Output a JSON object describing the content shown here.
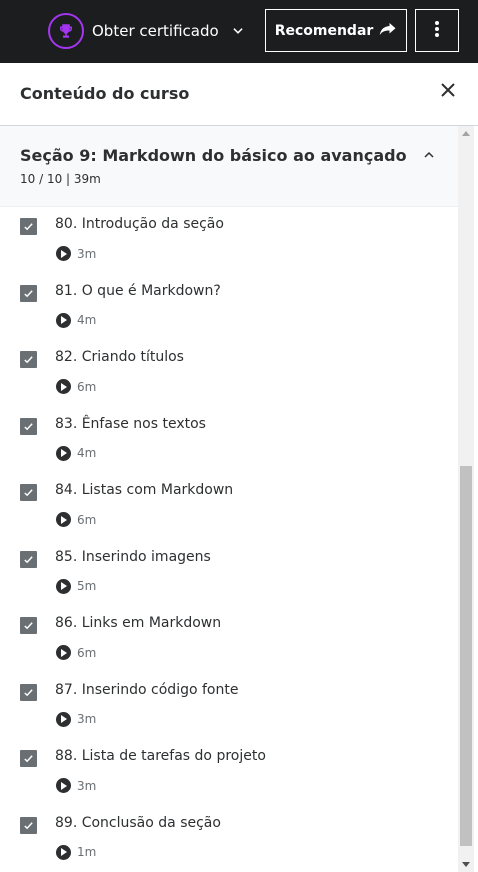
{
  "topbar": {
    "certificate_label": "Obter certificado",
    "recommend_label": "Recomendar"
  },
  "panel": {
    "title": "Conteúdo do curso"
  },
  "section": {
    "title": "Seção 9: Markdown do básico ao avançado",
    "meta": "10 / 10 | 39m"
  },
  "lectures": [
    {
      "title": "80. Introdução da seção",
      "duration": "3m",
      "completed": true
    },
    {
      "title": "81. O que é Markdown?",
      "duration": "4m",
      "completed": true
    },
    {
      "title": "82. Criando títulos",
      "duration": "6m",
      "completed": true
    },
    {
      "title": "83. Ênfase nos textos",
      "duration": "4m",
      "completed": true
    },
    {
      "title": "84. Listas com Markdown",
      "duration": "6m",
      "completed": true
    },
    {
      "title": "85. Inserindo imagens",
      "duration": "5m",
      "completed": true
    },
    {
      "title": "86. Links em Markdown",
      "duration": "6m",
      "completed": true
    },
    {
      "title": "87. Inserindo código fonte",
      "duration": "3m",
      "completed": true
    },
    {
      "title": "88. Lista de tarefas do projeto",
      "duration": "3m",
      "completed": true
    },
    {
      "title": "89. Conclusão da seção",
      "duration": "1m",
      "completed": true
    }
  ],
  "colors": {
    "topbar_bg": "#1c1d1f",
    "accent": "#a435f0",
    "checkbox": "#6a6f73",
    "section_bg": "#f7f9fa"
  },
  "icons": {
    "certificate": "trophy-icon",
    "dropdown": "chevron-down-icon",
    "recommend": "share-arrow-icon",
    "more": "more-vertical-icon",
    "close": "close-icon",
    "collapse": "chevron-up-icon",
    "check": "checkmark-icon",
    "play": "play-icon"
  }
}
